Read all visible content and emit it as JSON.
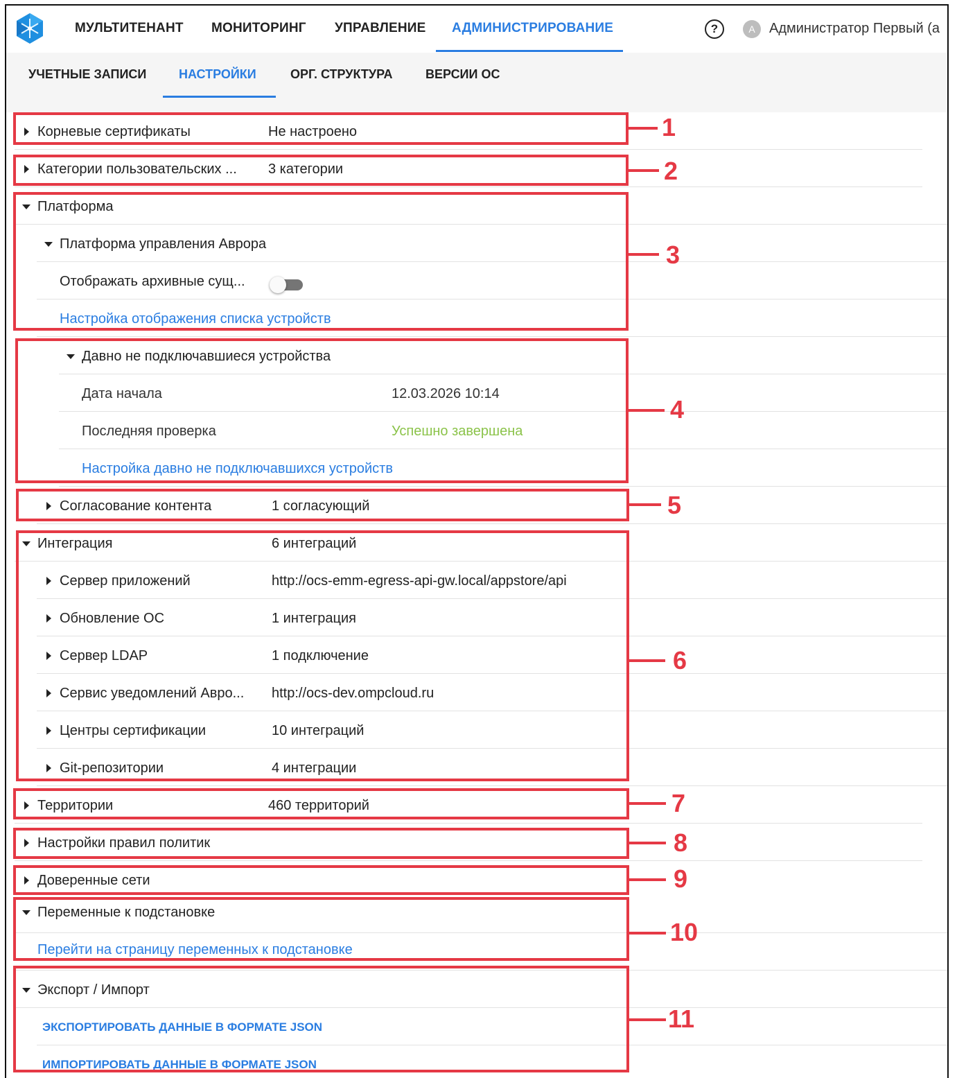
{
  "top_nav": {
    "items": [
      "МУЛЬТИТЕНАНТ",
      "МОНИТОРИНГ",
      "УПРАВЛЕНИЕ",
      "АДМИНИСТРИРОВАНИЕ"
    ],
    "help_symbol": "?",
    "avatar_letter": "A",
    "user_name": "Администратор Первый (а"
  },
  "sub_nav": {
    "items": [
      "УЧЕТНЫЕ ЗАПИСИ",
      "НАСТРОЙКИ",
      "ОРГ. СТРУКТУРА",
      "ВЕРСИИ ОС"
    ]
  },
  "sections": {
    "root_certs": {
      "label": "Корневые сертификаты",
      "value": "Не настроено"
    },
    "user_categories": {
      "label": "Категории пользовательских ...",
      "value": "3 категории"
    },
    "platform": {
      "label": "Платформа",
      "sub_label": "Платформа управления Аврора",
      "archive_label": "Отображать архивные сущ...",
      "archive_toggle_on": false,
      "device_list_link": "Настройка отображения списка устройств"
    },
    "inactive_devices": {
      "label": "Давно не подключавшиеся устройства",
      "start_date_label": "Дата начала",
      "start_date_value": "12.03.2026 10:14",
      "last_check_label": "Последняя проверка",
      "last_check_value": "Успешно завершена",
      "settings_link": "Настройка давно не подключавшихся устройств"
    },
    "content_approval": {
      "label": "Согласование контента",
      "value": "1 согласующий"
    },
    "integration": {
      "label": "Интеграция",
      "value": "6 интеграций",
      "items": [
        {
          "label": "Сервер приложений",
          "value": "http://ocs-emm-egress-api-gw.local/appstore/api"
        },
        {
          "label": "Обновление ОС",
          "value": "1 интеграция"
        },
        {
          "label": "Сервер LDAP",
          "value": "1 подключение"
        },
        {
          "label": "Сервис уведомлений Авро...",
          "value": "http://ocs-dev.ompcloud.ru"
        },
        {
          "label": "Центры сертификации",
          "value": "10 интеграций"
        },
        {
          "label": "Git-репозитории",
          "value": "4 интеграции"
        }
      ]
    },
    "territories": {
      "label": "Территории",
      "value": "460 территорий"
    },
    "policy_rules": {
      "label": "Настройки правил политик"
    },
    "trusted_networks": {
      "label": "Доверенные сети"
    },
    "variables": {
      "label": "Переменные к подстановке",
      "link": "Перейти на страницу переменных к подстановке"
    },
    "export_import": {
      "label": "Экспорт / Импорт",
      "export_link": "ЭКСПОРТИРОВАТЬ ДАННЫЕ В ФОРМАТЕ JSON",
      "import_link": "ИМПОРТИРОВАТЬ ДАННЫЕ В ФОРМАТЕ JSON"
    }
  },
  "callouts": [
    "1",
    "2",
    "3",
    "4",
    "5",
    "6",
    "7",
    "8",
    "9",
    "10",
    "11"
  ],
  "colors": {
    "accent": "#2a7de1",
    "highlight": "#e53945",
    "success": "#8bc34a"
  }
}
